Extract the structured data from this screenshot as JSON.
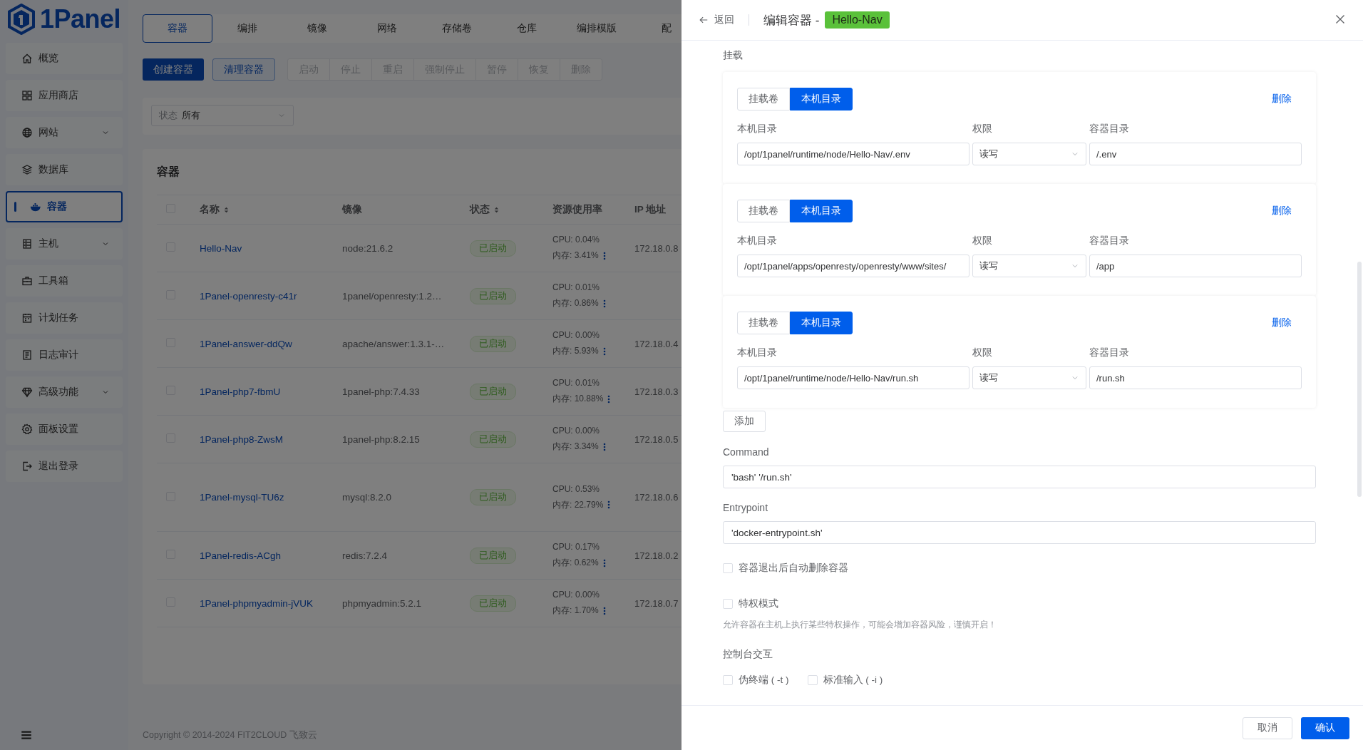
{
  "sidebar": {
    "logo": "1Panel",
    "items": [
      {
        "label": "概览",
        "selected": false,
        "expandable": false
      },
      {
        "label": "应用商店",
        "selected": false,
        "expandable": false
      },
      {
        "label": "网站",
        "selected": false,
        "expandable": true
      },
      {
        "label": "数据库",
        "selected": false,
        "expandable": false
      },
      {
        "label": "容器",
        "selected": true,
        "expandable": false
      },
      {
        "label": "主机",
        "selected": false,
        "expandable": true
      },
      {
        "label": "工具箱",
        "selected": false,
        "expandable": false
      },
      {
        "label": "计划任务",
        "selected": false,
        "expandable": false
      },
      {
        "label": "日志审计",
        "selected": false,
        "expandable": false
      },
      {
        "label": "高级功能",
        "selected": false,
        "expandable": true
      },
      {
        "label": "面板设置",
        "selected": false,
        "expandable": false
      },
      {
        "label": "退出登录",
        "selected": false,
        "expandable": false
      }
    ]
  },
  "tabs": [
    {
      "label": "容器",
      "selected": true
    },
    {
      "label": "编排",
      "selected": false
    },
    {
      "label": "镜像",
      "selected": false
    },
    {
      "label": "网络",
      "selected": false
    },
    {
      "label": "存储卷",
      "selected": false
    },
    {
      "label": "仓库",
      "selected": false
    },
    {
      "label": "编排模版",
      "selected": false
    },
    {
      "label": "配",
      "selected": false
    }
  ],
  "toolbar": {
    "buttons": [
      {
        "label": "创建容器",
        "kind": "primary"
      },
      {
        "label": "清理容器",
        "kind": "secondary"
      }
    ],
    "actions": [
      {
        "label": "启动",
        "disabled": true
      },
      {
        "label": "停止",
        "disabled": true
      },
      {
        "label": "重启",
        "disabled": true
      },
      {
        "label": "强制停止",
        "disabled": true
      },
      {
        "label": "暂停",
        "disabled": true
      },
      {
        "label": "恢复",
        "disabled": true
      },
      {
        "label": "删除",
        "disabled": true
      }
    ]
  },
  "filter": {
    "label": "状态",
    "value": "所有"
  },
  "table": {
    "title": "容器",
    "select_all_checked": false,
    "columns": [
      {
        "label": "名称",
        "sortable": true
      },
      {
        "label": "镜像",
        "sortable": false
      },
      {
        "label": "状态",
        "sortable": true
      },
      {
        "label": "资源使用率",
        "sortable": false
      },
      {
        "label": "IP 地址",
        "sortable": false
      }
    ],
    "rows": [
      {
        "checked": false,
        "name": "Hello-Nav",
        "image": "node:21.6.2",
        "status": "已启动",
        "cpu": "CPU: 0.04%",
        "memory": "内存: 3.41%",
        "ip": "172.18.0.8"
      },
      {
        "checked": false,
        "name": "1Panel-openresty-c41r",
        "image": "1panel/openresty:1.2…",
        "status": "已启动",
        "cpu": "CPU: 0.01%",
        "memory": "内存: 0.86%"
      },
      {
        "checked": false,
        "name": "1Panel-answer-ddQw",
        "image": "apache/answer:1.3.1-…",
        "status": "已启动",
        "cpu": "CPU: 0.00%",
        "memory": "内存: 5.93%",
        "ip": "172.18.0.4"
      },
      {
        "checked": false,
        "name": "1Panel-php7-fbmU",
        "image": "1panel-php:7.4.33",
        "status": "已启动",
        "cpu": "CPU: 0.01%",
        "memory": "内存: 10.88%",
        "ip": "172.18.0.3"
      },
      {
        "checked": false,
        "name": "1Panel-php8-ZwsM",
        "image": "1panel-php:8.2.15",
        "status": "已启动",
        "cpu": "CPU: 0.00%",
        "memory": "内存: 3.34%",
        "ip": "172.18.0.5"
      },
      {
        "checked": false,
        "name": "1Panel-mysql-TU6z",
        "image": "mysql:8.2.0",
        "status": "已启动",
        "cpu": "CPU: 0.53%",
        "memory": "内存: 22.79%",
        "ip": "172.18.0.6"
      },
      {
        "checked": false,
        "name": "1Panel-redis-ACgh",
        "image": "redis:7.2.4",
        "status": "已启动",
        "cpu": "CPU: 0.17%",
        "memory": "内存: 0.62%",
        "ip": "172.18.0.2"
      },
      {
        "checked": false,
        "name": "1Panel-phpmyadmin-jVUK",
        "image": "phpmyadmin:5.2.1",
        "status": "已启动",
        "cpu": "CPU: 0.00%",
        "memory": "内存: 1.70%",
        "ip": "172.18.0.7"
      }
    ]
  },
  "footer": "Copyright © 2014-2024 FIT2CLOUD 飞致云",
  "drawer": {
    "back": "返回",
    "title": "编辑容器 -",
    "tag": "Hello-Nav",
    "section": "挂载",
    "mounts": [
      {
        "modes": [
          {
            "label": "挂载卷",
            "selected": false
          },
          {
            "label": "本机目录",
            "selected": true
          }
        ],
        "delete": "删除",
        "host_label": "本机目录",
        "permission_label": "权限",
        "container_label": "容器目录",
        "host_path": "/opt/1panel/runtime/node/Hello-Nav/.env",
        "permission": "读写",
        "container_path": "/.env"
      },
      {
        "modes": [
          {
            "label": "挂载卷",
            "selected": false
          },
          {
            "label": "本机目录",
            "selected": true
          }
        ],
        "delete": "删除",
        "host_label": "本机目录",
        "permission_label": "权限",
        "container_label": "容器目录",
        "host_path": "/opt/1panel/apps/openresty/openresty/www/sites/",
        "permission": "读写",
        "container_path": "/app"
      },
      {
        "modes": [
          {
            "label": "挂载卷",
            "selected": false
          },
          {
            "label": "本机目录",
            "selected": true
          }
        ],
        "delete": "删除",
        "host_label": "本机目录",
        "permission_label": "权限",
        "container_label": "容器目录",
        "host_path": "/opt/1panel/runtime/node/Hello-Nav/run.sh",
        "permission": "读写",
        "container_path": "/run.sh"
      }
    ],
    "add": "添加",
    "command": {
      "label": "Command",
      "value": "'bash' '/run.sh'"
    },
    "entrypoint": {
      "label": "Entrypoint",
      "value": "'docker-entrypoint.sh'"
    },
    "auto_remove": {
      "label": "容器退出后自动删除容器",
      "checked": false
    },
    "privileged": {
      "label": "特权模式",
      "checked": false,
      "hint": "允许容器在主机上执行某些特权操作，可能会增加容器风险，谨慎开启！"
    },
    "console": {
      "label": "控制台交互",
      "options": [
        {
          "label": "伪终端 ( -t )",
          "checked": false
        },
        {
          "label": "标准输入 ( -i )",
          "checked": false
        }
      ]
    },
    "cancel": "取消",
    "confirm": "确认"
  }
}
